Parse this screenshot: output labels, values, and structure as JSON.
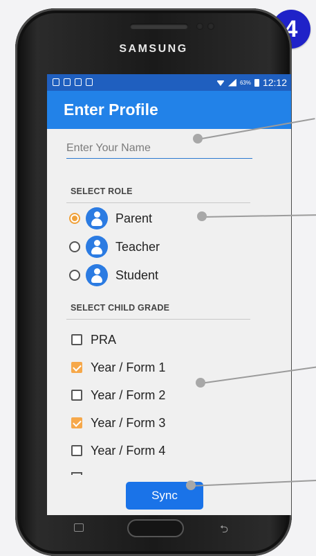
{
  "step_badge": "4",
  "device": {
    "brand": "SAMSUNG"
  },
  "status_bar": {
    "battery_text": "63%",
    "time": "12:12"
  },
  "app_bar": {
    "title": "Enter Profile"
  },
  "name_field": {
    "placeholder": "Enter Your Name",
    "value": ""
  },
  "role_section": {
    "label": "SELECT ROLE",
    "options": [
      {
        "label": "Parent",
        "selected": true
      },
      {
        "label": "Teacher",
        "selected": false
      },
      {
        "label": "Student",
        "selected": false
      }
    ]
  },
  "grade_section": {
    "label": "SELECT CHILD GRADE",
    "options": [
      {
        "label": "PRA",
        "checked": false
      },
      {
        "label": "Year / Form 1",
        "checked": true
      },
      {
        "label": "Year / Form 2",
        "checked": false
      },
      {
        "label": "Year / Form 3",
        "checked": true
      },
      {
        "label": "Year / Form 4",
        "checked": false
      }
    ]
  },
  "sync_button": {
    "label": "Sync"
  },
  "colors": {
    "app_bar": "#2282e8",
    "status_bar": "#1f5fbf",
    "accent": "#f6a84a",
    "button": "#1a73e8",
    "badge": "#1f22c8"
  }
}
